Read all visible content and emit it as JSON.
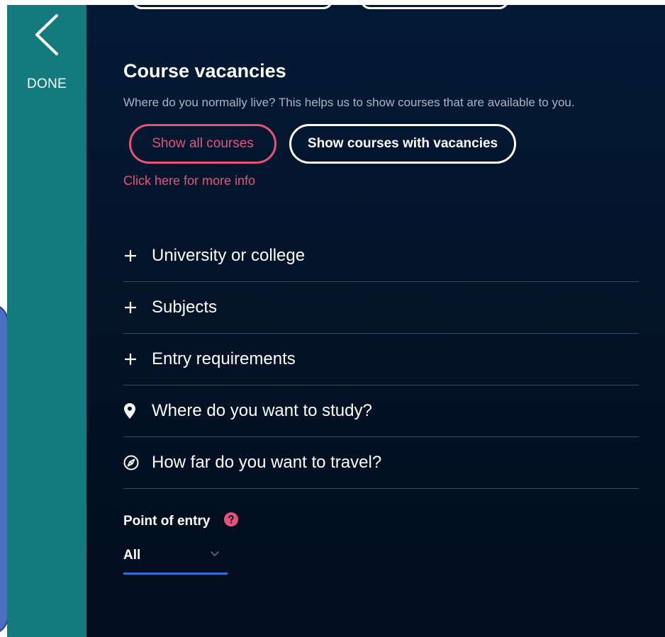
{
  "sidebar": {
    "done_label": "DONE"
  },
  "course_vacancies": {
    "title": "Course vacancies",
    "subtitle": "Where do you normally live? This helps us to show courses that are available to you.",
    "show_all_label": "Show all courses",
    "show_vacancies_label": "Show courses with vacancies",
    "more_info_link": "Click here for more info"
  },
  "filters": [
    {
      "icon": "plus-icon",
      "label": "University or college"
    },
    {
      "icon": "plus-icon",
      "label": "Subjects"
    },
    {
      "icon": "plus-icon",
      "label": "Entry requirements"
    },
    {
      "icon": "map-pin-icon",
      "label": "Where do you want to study?"
    },
    {
      "icon": "compass-icon",
      "label": "How far do you want to travel?"
    }
  ],
  "point_of_entry": {
    "label": "Point of entry",
    "selected": "All"
  },
  "colors": {
    "teal": "#137a7d",
    "navy": "#031a35",
    "pink": "#e8527a",
    "select_underline": "#2f6fd6"
  }
}
